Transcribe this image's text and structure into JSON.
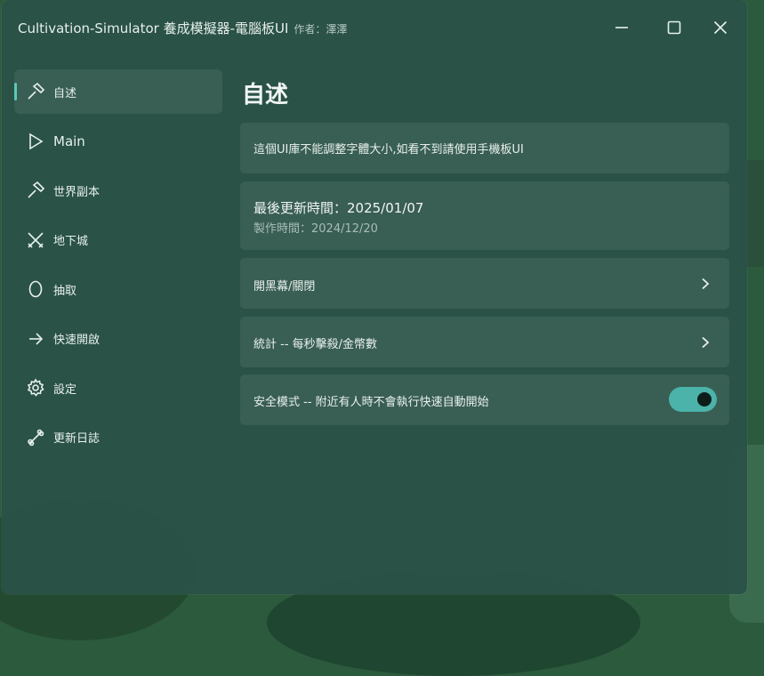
{
  "window": {
    "title": "Cultivation-Simulator 養成模擬器-電腦板UI",
    "author": "作者：澤澤",
    "controls": [
      "minimize-icon",
      "maximize-icon",
      "close-icon"
    ]
  },
  "sidebar": {
    "items": [
      {
        "label": "自述",
        "icon": "hammer-icon",
        "active": true
      },
      {
        "label": "Main",
        "icon": "play-icon",
        "active": false
      },
      {
        "label": "世界副本",
        "icon": "hammer-icon",
        "active": false
      },
      {
        "label": "地下城",
        "icon": "crossed-swords-icon",
        "active": false
      },
      {
        "label": "抽取",
        "icon": "egg-icon",
        "active": false
      },
      {
        "label": "快速開啟",
        "icon": "arrow-right-icon",
        "active": false
      },
      {
        "label": "設定",
        "icon": "gear-icon",
        "active": false
      },
      {
        "label": "更新日誌",
        "icon": "bone-icon",
        "active": false
      }
    ]
  },
  "main": {
    "title": "自述",
    "notice": "這個UI庫不能調整字體大小,如看不到請使用手機板UI",
    "update": {
      "last_updated": "最後更新時間：2025/01/07",
      "created": "製作時間：2024/12/20"
    },
    "rows": [
      {
        "label": "開黑幕/關閉",
        "type": "chevron"
      },
      {
        "label": "統計 -- 每秒擊殺/金幣數",
        "type": "chevron"
      },
      {
        "label": "安全模式 -- 附近有人時不會執行快速自動開始",
        "type": "toggle",
        "value": true
      }
    ]
  },
  "colors": {
    "accent": "#4bb3a9",
    "window_bg": "#2a5248",
    "indicator": "#5ec9b8"
  }
}
